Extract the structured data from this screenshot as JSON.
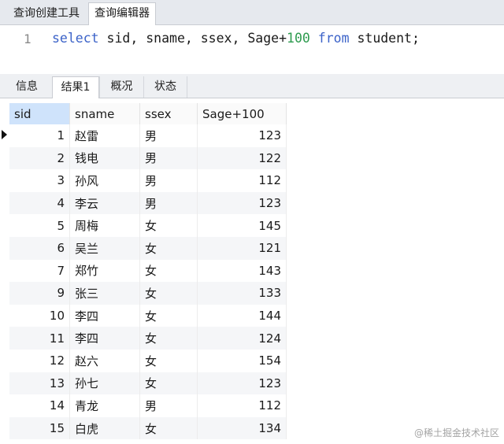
{
  "top_tabs": [
    "查询创建工具",
    "查询编辑器"
  ],
  "editor": {
    "line_number": "1",
    "tokens": {
      "select": "select",
      "cols": " sid, sname, ssex, Sage+",
      "num": "100",
      "from": " from",
      "rest": " student;"
    }
  },
  "result_tabs": [
    "信息",
    "结果1",
    "概况",
    "状态"
  ],
  "grid": {
    "columns": [
      "sid",
      "sname",
      "ssex",
      "Sage+100"
    ],
    "rows": [
      [
        "1",
        "赵雷",
        "男",
        "123"
      ],
      [
        "2",
        "钱电",
        "男",
        "122"
      ],
      [
        "3",
        "孙风",
        "男",
        "112"
      ],
      [
        "4",
        "李云",
        "男",
        "123"
      ],
      [
        "5",
        "周梅",
        "女",
        "145"
      ],
      [
        "6",
        "吴兰",
        "女",
        "121"
      ],
      [
        "7",
        "郑竹",
        "女",
        "143"
      ],
      [
        "9",
        "张三",
        "女",
        "133"
      ],
      [
        "10",
        "李四",
        "女",
        "144"
      ],
      [
        "11",
        "李四",
        "女",
        "124"
      ],
      [
        "12",
        "赵六",
        "女",
        "154"
      ],
      [
        "13",
        "孙七",
        "女",
        "123"
      ],
      [
        "14",
        "青龙",
        "男",
        "112"
      ],
      [
        "15",
        "白虎",
        "女",
        "134"
      ]
    ]
  },
  "watermark": "@稀土掘金技术社区"
}
